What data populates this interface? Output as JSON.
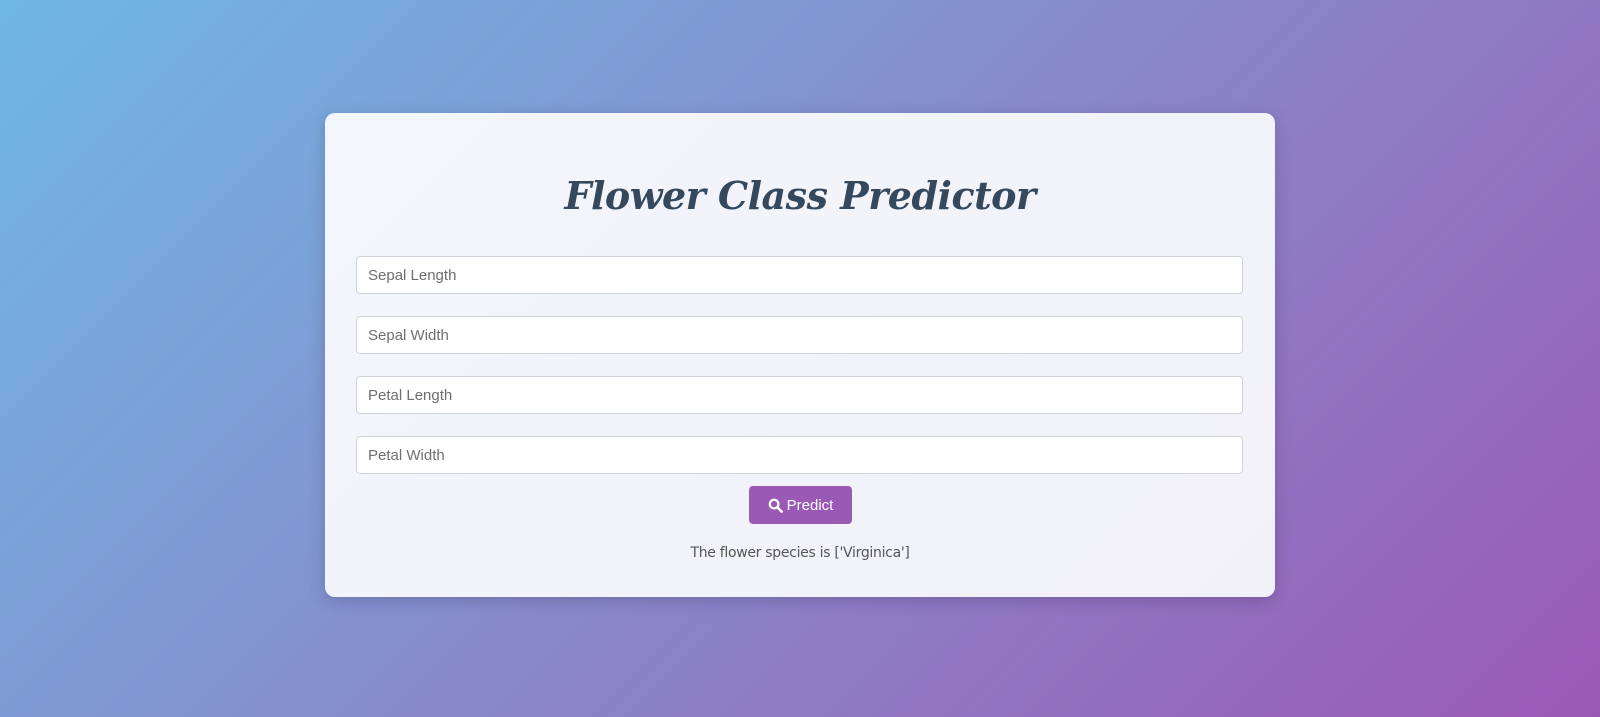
{
  "form": {
    "title": "Flower Class Predictor",
    "fields": [
      {
        "placeholder": "Sepal Length",
        "value": ""
      },
      {
        "placeholder": "Sepal Width",
        "value": ""
      },
      {
        "placeholder": "Petal Length",
        "value": ""
      },
      {
        "placeholder": "Petal Width",
        "value": ""
      }
    ],
    "submit": {
      "label": "Predict",
      "icon": "search-icon"
    },
    "result": "The flower species is ['Virginica']"
  },
  "colors": {
    "background_start": "#6fb8e6",
    "background_end": "#9b59b6",
    "card": "#f3f4fa",
    "title": "#34495e",
    "button": "#9b59b6",
    "button_text": "#ffffff"
  }
}
